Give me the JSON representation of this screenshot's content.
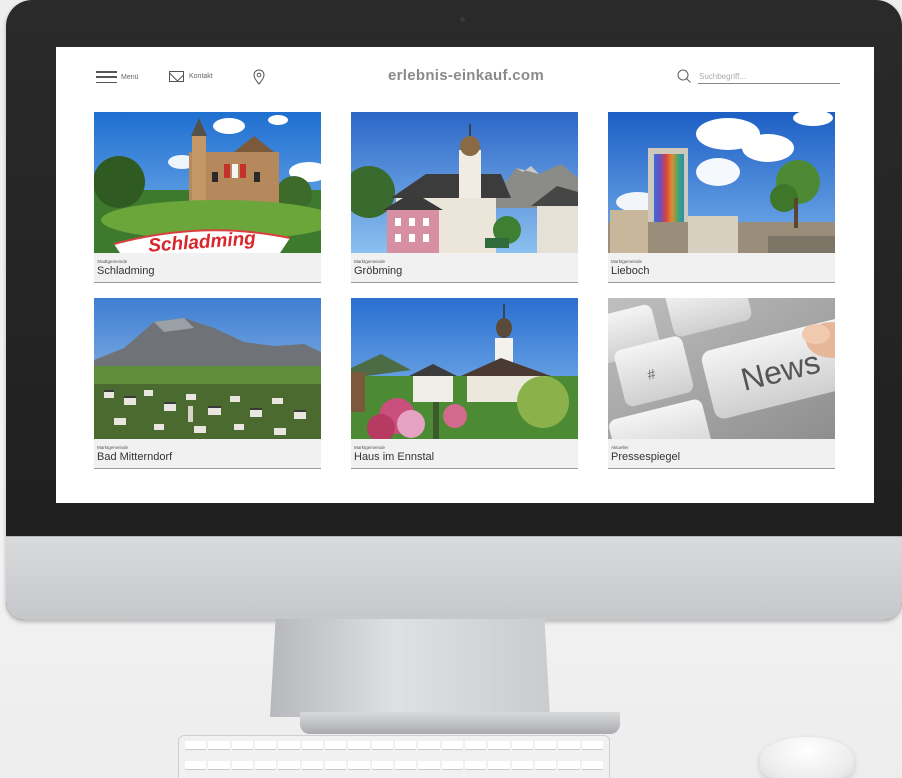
{
  "site": {
    "brand": "erlebnis-einkauf.com",
    "nav": {
      "menu_label": "Menü",
      "contact_label": "Kontakt"
    },
    "search": {
      "placeholder": "Suchbegriff..."
    }
  },
  "tiles": [
    {
      "category": "Stadtgemeinde",
      "name": "Schladming",
      "image_text": "Schladming"
    },
    {
      "category": "Marktgemeinde",
      "name": "Gröbming"
    },
    {
      "category": "Marktgemeinde",
      "name": "Lieboch"
    },
    {
      "category": "Marktgemeinde",
      "name": "Bad Mitterndorf"
    },
    {
      "category": "Marktgemeinde",
      "name": "Haus im Ennstal"
    },
    {
      "category": "Aktueller",
      "name": "Pressespiegel",
      "image_text": "News",
      "key_symbol": "#"
    }
  ],
  "icons": {
    "menu": "hamburger-icon",
    "contact": "envelope-icon",
    "location": "map-pin-icon",
    "search": "search-icon"
  },
  "colors": {
    "brand_text": "#8a8a8a",
    "caption_bg": "#f1f1f1",
    "bezel": "#1e1e1e",
    "chin": "#cfd1d4"
  }
}
